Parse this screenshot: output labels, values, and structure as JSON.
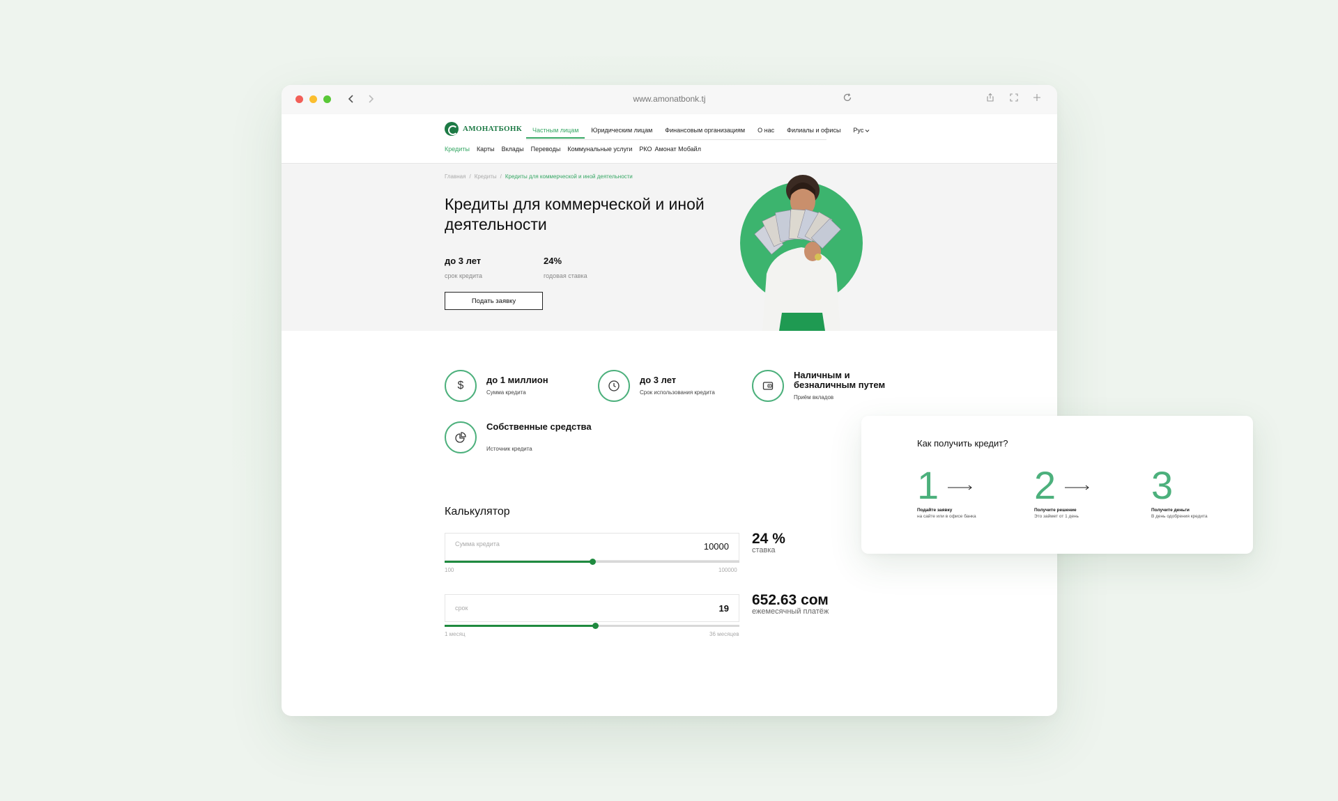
{
  "browser": {
    "url": "www.amonatbonk.tj"
  },
  "header": {
    "logo_text": "АМОНАТБОНК",
    "top_nav": [
      "Частным лицам",
      "Юридическим лицам",
      "Финансовым организациям",
      "О нас",
      "Филиалы и офисы"
    ],
    "language": "Рус",
    "sub_nav": [
      "Кредиты",
      "Карты",
      "Вклады",
      "Переводы",
      "Коммунальные услуги",
      "РКО",
      "Амонат Мобайл"
    ]
  },
  "hero": {
    "breadcrumb": [
      "Главная",
      "Кредиты",
      "Кредиты для коммерческой и иной деятельности"
    ],
    "title": "Кредиты для коммерческой и иной деятельности",
    "stats": [
      {
        "value": "до 3 лет",
        "label": "срок кредита"
      },
      {
        "value": "24%",
        "label": "годовая ставка"
      }
    ],
    "apply_button": "Подать заявку"
  },
  "features": [
    {
      "icon": "dollar-icon",
      "title": "до 1 миллион",
      "sub": "Сумма кредита"
    },
    {
      "icon": "clock-icon",
      "title": "до 3 лет",
      "sub": "Срок использования кредита"
    },
    {
      "icon": "wallet-icon",
      "title": "Наличным и безналичным путем",
      "sub": "Приём вкладов"
    },
    {
      "icon": "pie-chart-icon",
      "title": "Собственные средства",
      "sub": "Источник кредита"
    }
  ],
  "calculator": {
    "title": "Калькулятор",
    "amount": {
      "placeholder": "Сумма кредита",
      "value": "10000",
      "min_label": "100",
      "max_label": "100000",
      "fill_fraction": 0.5
    },
    "term": {
      "placeholder": "срок",
      "value": "19",
      "min_label": "1 месяц",
      "max_label": "36 месяцев",
      "fill_fraction": 0.51
    },
    "rate": {
      "value": "24 %",
      "label": "ставка"
    },
    "payment": {
      "value": "652.63 сом",
      "label": "ежемесячный платёж"
    }
  },
  "how_to": {
    "title": "Как получить кредит?",
    "steps": [
      {
        "num": "1",
        "title": "Подайте заявку",
        "sub": "на сайте или в офисе банка"
      },
      {
        "num": "2",
        "title": "Получите решение",
        "sub": "Это займет от 1 день"
      },
      {
        "num": "3",
        "title": "Получите деньги",
        "sub": "В день одобрения кредита"
      }
    ]
  },
  "colors": {
    "accent": "#36a764",
    "brand": "#1d7a45",
    "slider": "#1f8a3f"
  }
}
